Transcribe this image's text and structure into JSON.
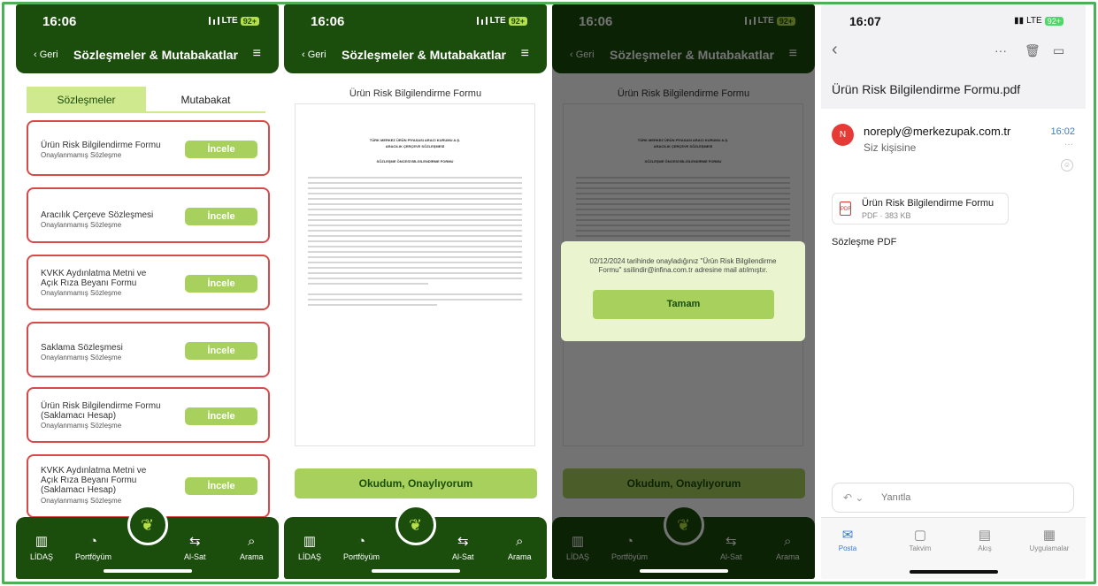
{
  "status": {
    "time_1": "16:06",
    "time_4": "16:07",
    "network": "LTE",
    "battery": "92+"
  },
  "header": {
    "back_label": "Geri",
    "title": "Sözleşmeler & Mutabakatlar"
  },
  "tabs": [
    "Sözleşmeler",
    "Mutabakat"
  ],
  "contracts": [
    {
      "name": "Ürün Risk Bilgilendirme Formu",
      "status": "Onaylanmamış Sözleşme",
      "button": "İncele"
    },
    {
      "name": "Aracılık Çerçeve Sözleşmesi",
      "status": "Onaylanmamış Sözleşme",
      "button": "İncele"
    },
    {
      "name": "KVKK Aydınlatma Metni ve\nAçık Rıza Beyanı Formu",
      "status": "Onaylanmamış Sözleşme",
      "button": "İncele"
    },
    {
      "name": "Saklama Sözleşmesi",
      "status": "Onaylanmamış Sözleşme",
      "button": "İncele"
    },
    {
      "name": "Ürün Risk Bilgilendirme Formu\n(Saklamacı Hesap)",
      "status": "Onaylanmamış Sözleşme",
      "button": "İncele"
    },
    {
      "name": "KVKK Aydınlatma Metni ve\nAçık Rıza Beyanı Formu\n(Saklamacı Hesap)",
      "status": "Onaylanmamış Sözleşme",
      "button": "İncele"
    }
  ],
  "nav": [
    "LİDAŞ",
    "Portföyüm",
    "Al-Sat",
    "Arama"
  ],
  "document": {
    "title": "Ürün Risk Bilgilendirme Formu",
    "heading_1": "TÜRK MERKEZ ÜRÜN PİYASASI ARACI KURUMU A.Ş.",
    "heading_2": "ARACILIK ÇERÇEVE SÖZLEŞMESİ",
    "heading_3": "SÖZLEŞME ÖNCESİ BİLGİLENDİRME FORMU",
    "confirm_button": "Okudum, Onaylıyorum"
  },
  "modal": {
    "message": "02/12/2024 tarihinde onayladığınız \"Ürün Risk Bilgilendirme Formu\" ssilindir@infina.com.tr adresine mail atılmıştır.",
    "ok_button": "Tamam"
  },
  "mail": {
    "subject": "Ürün Risk Bilgilendirme Formu.pdf",
    "avatar_letter": "N",
    "from": "noreply@merkezupak.com.tr",
    "to": "Siz kişisine",
    "time": "16:02",
    "attachment_name": "Ürün Risk Bilgilendirme Formu",
    "attachment_meta": "PDF · 383 KB",
    "body": "Sözleşme PDF",
    "reply_placeholder": "Yanıtla",
    "tabbar": [
      "Posta",
      "Takvim",
      "Akış",
      "Uygulamalar"
    ]
  },
  "colors": {
    "brand_green": "#1b4d0c",
    "accent_lime": "#a7d15c",
    "alert_red": "#d84a4a",
    "ios_blue": "#3a7bd5"
  }
}
